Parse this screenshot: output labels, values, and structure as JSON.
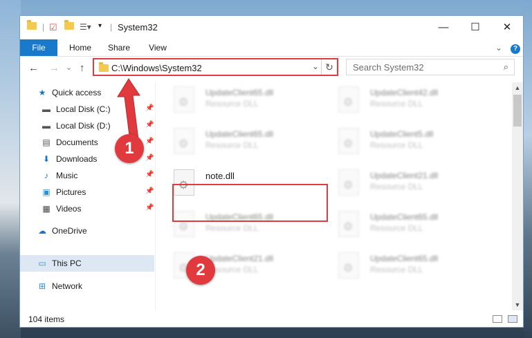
{
  "window": {
    "title": "System32"
  },
  "title_buttons": {
    "minimize": "—",
    "maximize": "☐",
    "close": "✕"
  },
  "ribbon": {
    "tabs": [
      "File",
      "Home",
      "Share",
      "View"
    ],
    "expand": "⌄",
    "help": "?"
  },
  "address": {
    "path": "C:\\Windows\\System32",
    "refresh": "↻",
    "dropdown": "⌄"
  },
  "search": {
    "placeholder": "Search System32"
  },
  "nav": {
    "back": "←",
    "forward": "→",
    "recent": "⌄",
    "up": "↑",
    "items": [
      {
        "label": "Quick access",
        "icon": "star-icon",
        "glyph": "★",
        "color": "#1a73c7"
      },
      {
        "label": "Local Disk (C:)",
        "icon": "drive-icon",
        "glyph": "▬",
        "color": "#555"
      },
      {
        "label": "Local Disk (D:)",
        "icon": "drive-icon",
        "glyph": "▬",
        "color": "#555"
      },
      {
        "label": "Documents",
        "icon": "documents-icon",
        "glyph": "▤",
        "color": "#555"
      },
      {
        "label": "Downloads",
        "icon": "downloads-icon",
        "glyph": "⬇",
        "color": "#1a73c7"
      },
      {
        "label": "Music",
        "icon": "music-icon",
        "glyph": "♪",
        "color": "#1a73c7"
      },
      {
        "label": "Pictures",
        "icon": "pictures-icon",
        "glyph": "▣",
        "color": "#2b8fd6"
      },
      {
        "label": "Videos",
        "icon": "videos-icon",
        "glyph": "▦",
        "color": "#444"
      },
      {
        "label": "OneDrive",
        "icon": "onedrive-icon",
        "glyph": "☁",
        "color": "#1a73c7"
      },
      {
        "label": "This PC",
        "icon": "pc-icon",
        "glyph": "▭",
        "color": "#2b8fd6"
      },
      {
        "label": "Network",
        "icon": "network-icon",
        "glyph": "⊞",
        "color": "#2b8fd6"
      }
    ],
    "pin_glyph": "📌"
  },
  "files": [
    {
      "name": "UpdateClient65.dll",
      "type": "Resource DLL"
    },
    {
      "name": "UpdateClient42.dll",
      "type": "Resource DLL"
    },
    {
      "name": "UpdateClient65.dll",
      "type": "Resource DLL"
    },
    {
      "name": "UpdateClient5.dll",
      "type": "Resource DLL"
    },
    {
      "name": "note.dll",
      "type": ""
    },
    {
      "name": "UpdateClient21.dll",
      "type": "Resource DLL"
    },
    {
      "name": "UpdateClient65.dll",
      "type": "Resource DLL"
    },
    {
      "name": "UpdateClient65.dll",
      "type": "Resource DLL"
    },
    {
      "name": "UpdateClient21.dll",
      "type": "Resource DLL"
    },
    {
      "name": "UpdateClient65.dll",
      "type": "Resource DLL"
    }
  ],
  "status": {
    "count": "104 items"
  },
  "annotations": {
    "step1": "1",
    "step2": "2",
    "color": "#e0393e"
  }
}
